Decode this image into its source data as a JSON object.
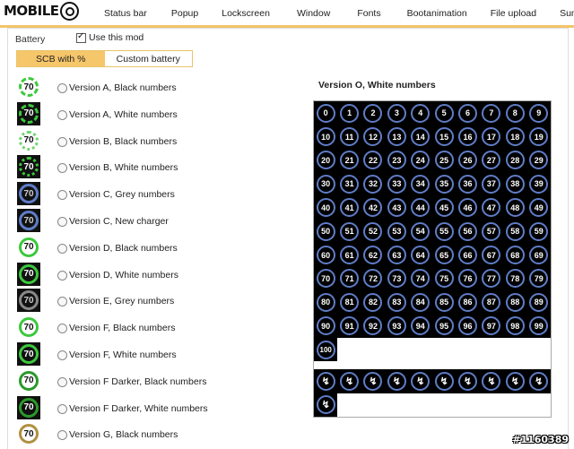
{
  "nav": {
    "logo_text": "MOBILE",
    "tabs": [
      "Status bar",
      "Popup",
      "Lockscreen",
      "Window",
      "Fonts",
      "Bootanimation",
      "File upload",
      "Summary"
    ]
  },
  "battery": {
    "section_label": "Battery",
    "use_mod_label": "Use this mod",
    "use_mod_checked": true,
    "subtabs": [
      {
        "label": "SCB with %",
        "active": true
      },
      {
        "label": "Custom battery",
        "active": false
      }
    ]
  },
  "versions": [
    {
      "label": "Version A, Black numbers",
      "icon": "battery-a-black-icon",
      "number": "70"
    },
    {
      "label": "Version A, White numbers",
      "icon": "battery-a-white-icon",
      "number": "70"
    },
    {
      "label": "Version B, Black numbers",
      "icon": "battery-b-black-icon",
      "number": "70"
    },
    {
      "label": "Version B, White numbers",
      "icon": "battery-b-white-icon",
      "number": "70"
    },
    {
      "label": "Version C, Grey numbers",
      "icon": "battery-c-grey-icon",
      "number": "70"
    },
    {
      "label": "Version C, New charger",
      "icon": "battery-c-charger-icon",
      "number": "70"
    },
    {
      "label": "Version D, Black numbers",
      "icon": "battery-d-black-icon",
      "number": "70"
    },
    {
      "label": "Version D, White numbers",
      "icon": "battery-d-white-icon",
      "number": "70"
    },
    {
      "label": "Version E, Grey numbers",
      "icon": "battery-e-grey-icon",
      "number": "70"
    },
    {
      "label": "Version F, Black numbers",
      "icon": "battery-f-black-icon",
      "number": "70"
    },
    {
      "label": "Version F, White numbers",
      "icon": "battery-f-white-icon",
      "number": "70"
    },
    {
      "label": "Version F Darker, Black numbers",
      "icon": "battery-f-darker-black-icon",
      "number": "70"
    },
    {
      "label": "Version F Darker, White numbers",
      "icon": "battery-f-darker-white-icon",
      "number": "70"
    },
    {
      "label": "Version G, Black numbers",
      "icon": "battery-g-black-icon",
      "number": "70"
    }
  ],
  "preview": {
    "title": "Version O, White numbers",
    "numbers": [
      "0",
      "1",
      "2",
      "3",
      "4",
      "5",
      "6",
      "7",
      "8",
      "9",
      "10",
      "11",
      "12",
      "13",
      "14",
      "15",
      "16",
      "17",
      "18",
      "19",
      "20",
      "21",
      "22",
      "23",
      "24",
      "25",
      "26",
      "27",
      "28",
      "29",
      "30",
      "31",
      "32",
      "33",
      "34",
      "35",
      "36",
      "37",
      "38",
      "39",
      "40",
      "41",
      "42",
      "43",
      "44",
      "45",
      "46",
      "47",
      "48",
      "49",
      "50",
      "51",
      "52",
      "53",
      "54",
      "55",
      "56",
      "57",
      "58",
      "59",
      "60",
      "61",
      "62",
      "63",
      "64",
      "65",
      "66",
      "67",
      "68",
      "69",
      "70",
      "71",
      "72",
      "73",
      "74",
      "75",
      "76",
      "77",
      "78",
      "79",
      "80",
      "81",
      "82",
      "83",
      "84",
      "85",
      "86",
      "87",
      "88",
      "89",
      "90",
      "91",
      "92",
      "93",
      "94",
      "95",
      "96",
      "97",
      "98",
      "99",
      "100"
    ],
    "charge_icon": "charging-bolt-icon"
  },
  "colors": {
    "accent": "#f6c66a",
    "ring_blue": "#5f7dc7",
    "ring_green": "#32c832"
  },
  "watermark": "#1160389"
}
